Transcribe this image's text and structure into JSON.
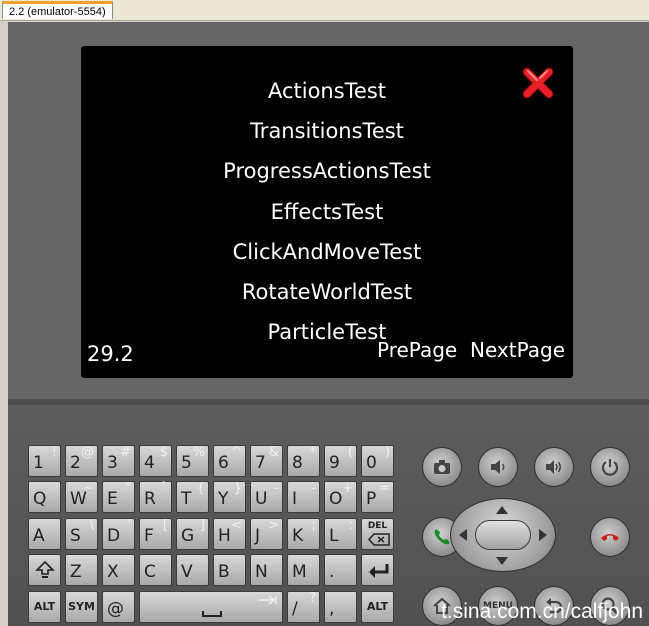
{
  "window": {
    "tab_title": "2.2 (emulator-5554)"
  },
  "screen": {
    "menu_items": [
      "ActionsTest",
      "TransitionsTest",
      "ProgressActionsTest",
      "EffectsTest",
      "ClickAndMoveTest",
      "RotateWorldTest",
      "ParticleTest"
    ],
    "fps": "29.2",
    "prev_label": "PrePage",
    "next_label": "NextPage"
  },
  "keyboard": {
    "row1": [
      [
        "1",
        "!"
      ],
      [
        "2",
        "@"
      ],
      [
        "3",
        "#"
      ],
      [
        "4",
        "$"
      ],
      [
        "5",
        "%"
      ],
      [
        "6",
        "^"
      ],
      [
        "7",
        "&"
      ],
      [
        "8",
        "*"
      ],
      [
        "9",
        "("
      ],
      [
        "0",
        ")"
      ]
    ],
    "row2": [
      [
        "Q",
        ""
      ],
      [
        "W",
        "~"
      ],
      [
        "E",
        "\""
      ],
      [
        "R",
        "`"
      ],
      [
        "T",
        "{"
      ],
      [
        "Y",
        "}"
      ],
      [
        "U",
        "-"
      ],
      [
        "I",
        "-"
      ],
      [
        "O",
        "+"
      ],
      [
        "P",
        "="
      ]
    ],
    "row3": [
      [
        "A",
        ""
      ],
      [
        "S",
        "\\"
      ],
      [
        "D",
        "'"
      ],
      [
        "F",
        "["
      ],
      [
        "G",
        "]"
      ],
      [
        "H",
        "<"
      ],
      [
        "J",
        ">"
      ],
      [
        "K",
        ";"
      ],
      [
        "L",
        ":"
      ]
    ],
    "del_label": "DEL",
    "row4": [
      [
        "Z",
        ""
      ],
      [
        "X",
        ""
      ],
      [
        "C",
        ""
      ],
      [
        "V",
        ""
      ],
      [
        "B",
        ""
      ],
      [
        "N",
        ""
      ],
      [
        "M",
        ""
      ],
      [
        ".",
        ""
      ]
    ],
    "alt_label": "ALT",
    "sym_label": "SYM",
    "at_label": "@",
    "slash_key": [
      "/",
      "?"
    ],
    "comma_key": [
      ",",
      ""
    ]
  },
  "hardware": {
    "menu_label": "MENU"
  },
  "watermark": "t.sina.com.cn/calfjohn"
}
